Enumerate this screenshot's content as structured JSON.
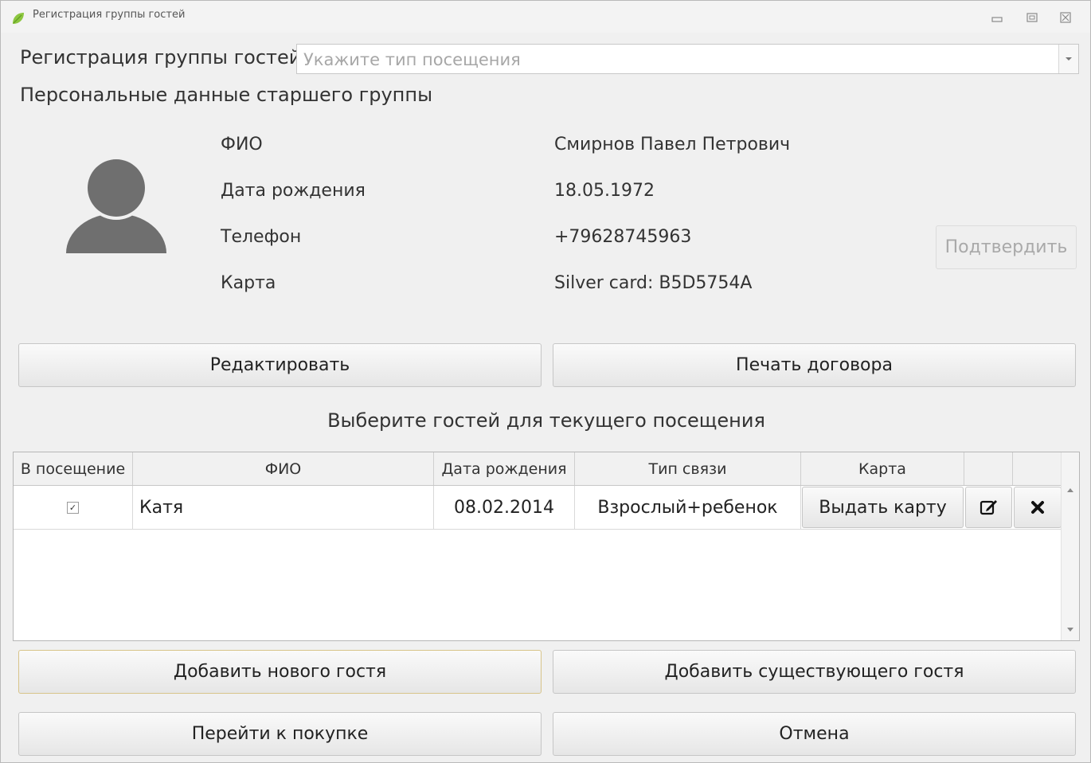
{
  "window": {
    "title": "Регистрация группы гостей",
    "app_icon": "leaf-icon",
    "controls": [
      "minimize-icon",
      "maximize-icon",
      "close-icon"
    ]
  },
  "header": {
    "label": "Регистрация группы гостей",
    "visit_type_placeholder": "Укажите тип посещения"
  },
  "personal": {
    "title": "Персональные данные старшего группы",
    "avatar_icon": "user-avatar-icon",
    "fields": [
      {
        "label": "ФИО",
        "value": "Смирнов Павел Петрович"
      },
      {
        "label": "Дата рождения",
        "value": "18.05.1972"
      },
      {
        "label": "Телефон",
        "value": "+79628745963"
      },
      {
        "label": "Карта",
        "value": "Silver card: B5D5754A"
      }
    ],
    "confirm_label": "Подтвердить",
    "edit_label": "Редактировать",
    "print_label": "Печать договора"
  },
  "guests": {
    "title": "Выберите гостей для текущего посещения",
    "columns": [
      "В посещение",
      "ФИО",
      "Дата рождения",
      "Тип связи",
      "Карта",
      "",
      ""
    ],
    "rows": [
      {
        "checked": true,
        "name": "Катя",
        "birth_date": "08.02.2014",
        "relation": "Взрослый+ребенок",
        "card_action": "Выдать карту",
        "edit_icon": "edit-icon",
        "delete_icon": "delete-icon"
      }
    ]
  },
  "actions": {
    "add_new": "Добавить нового гостя",
    "add_existing": "Добавить существующего гостя",
    "purchase": "Перейти к покупке",
    "cancel": "Отмена"
  },
  "colors": {
    "window_bg": "#f0f0f0",
    "avatar": "#6f6f6f",
    "app_icon": "#8cc63f",
    "disabled_text": "#a9a9a9"
  }
}
